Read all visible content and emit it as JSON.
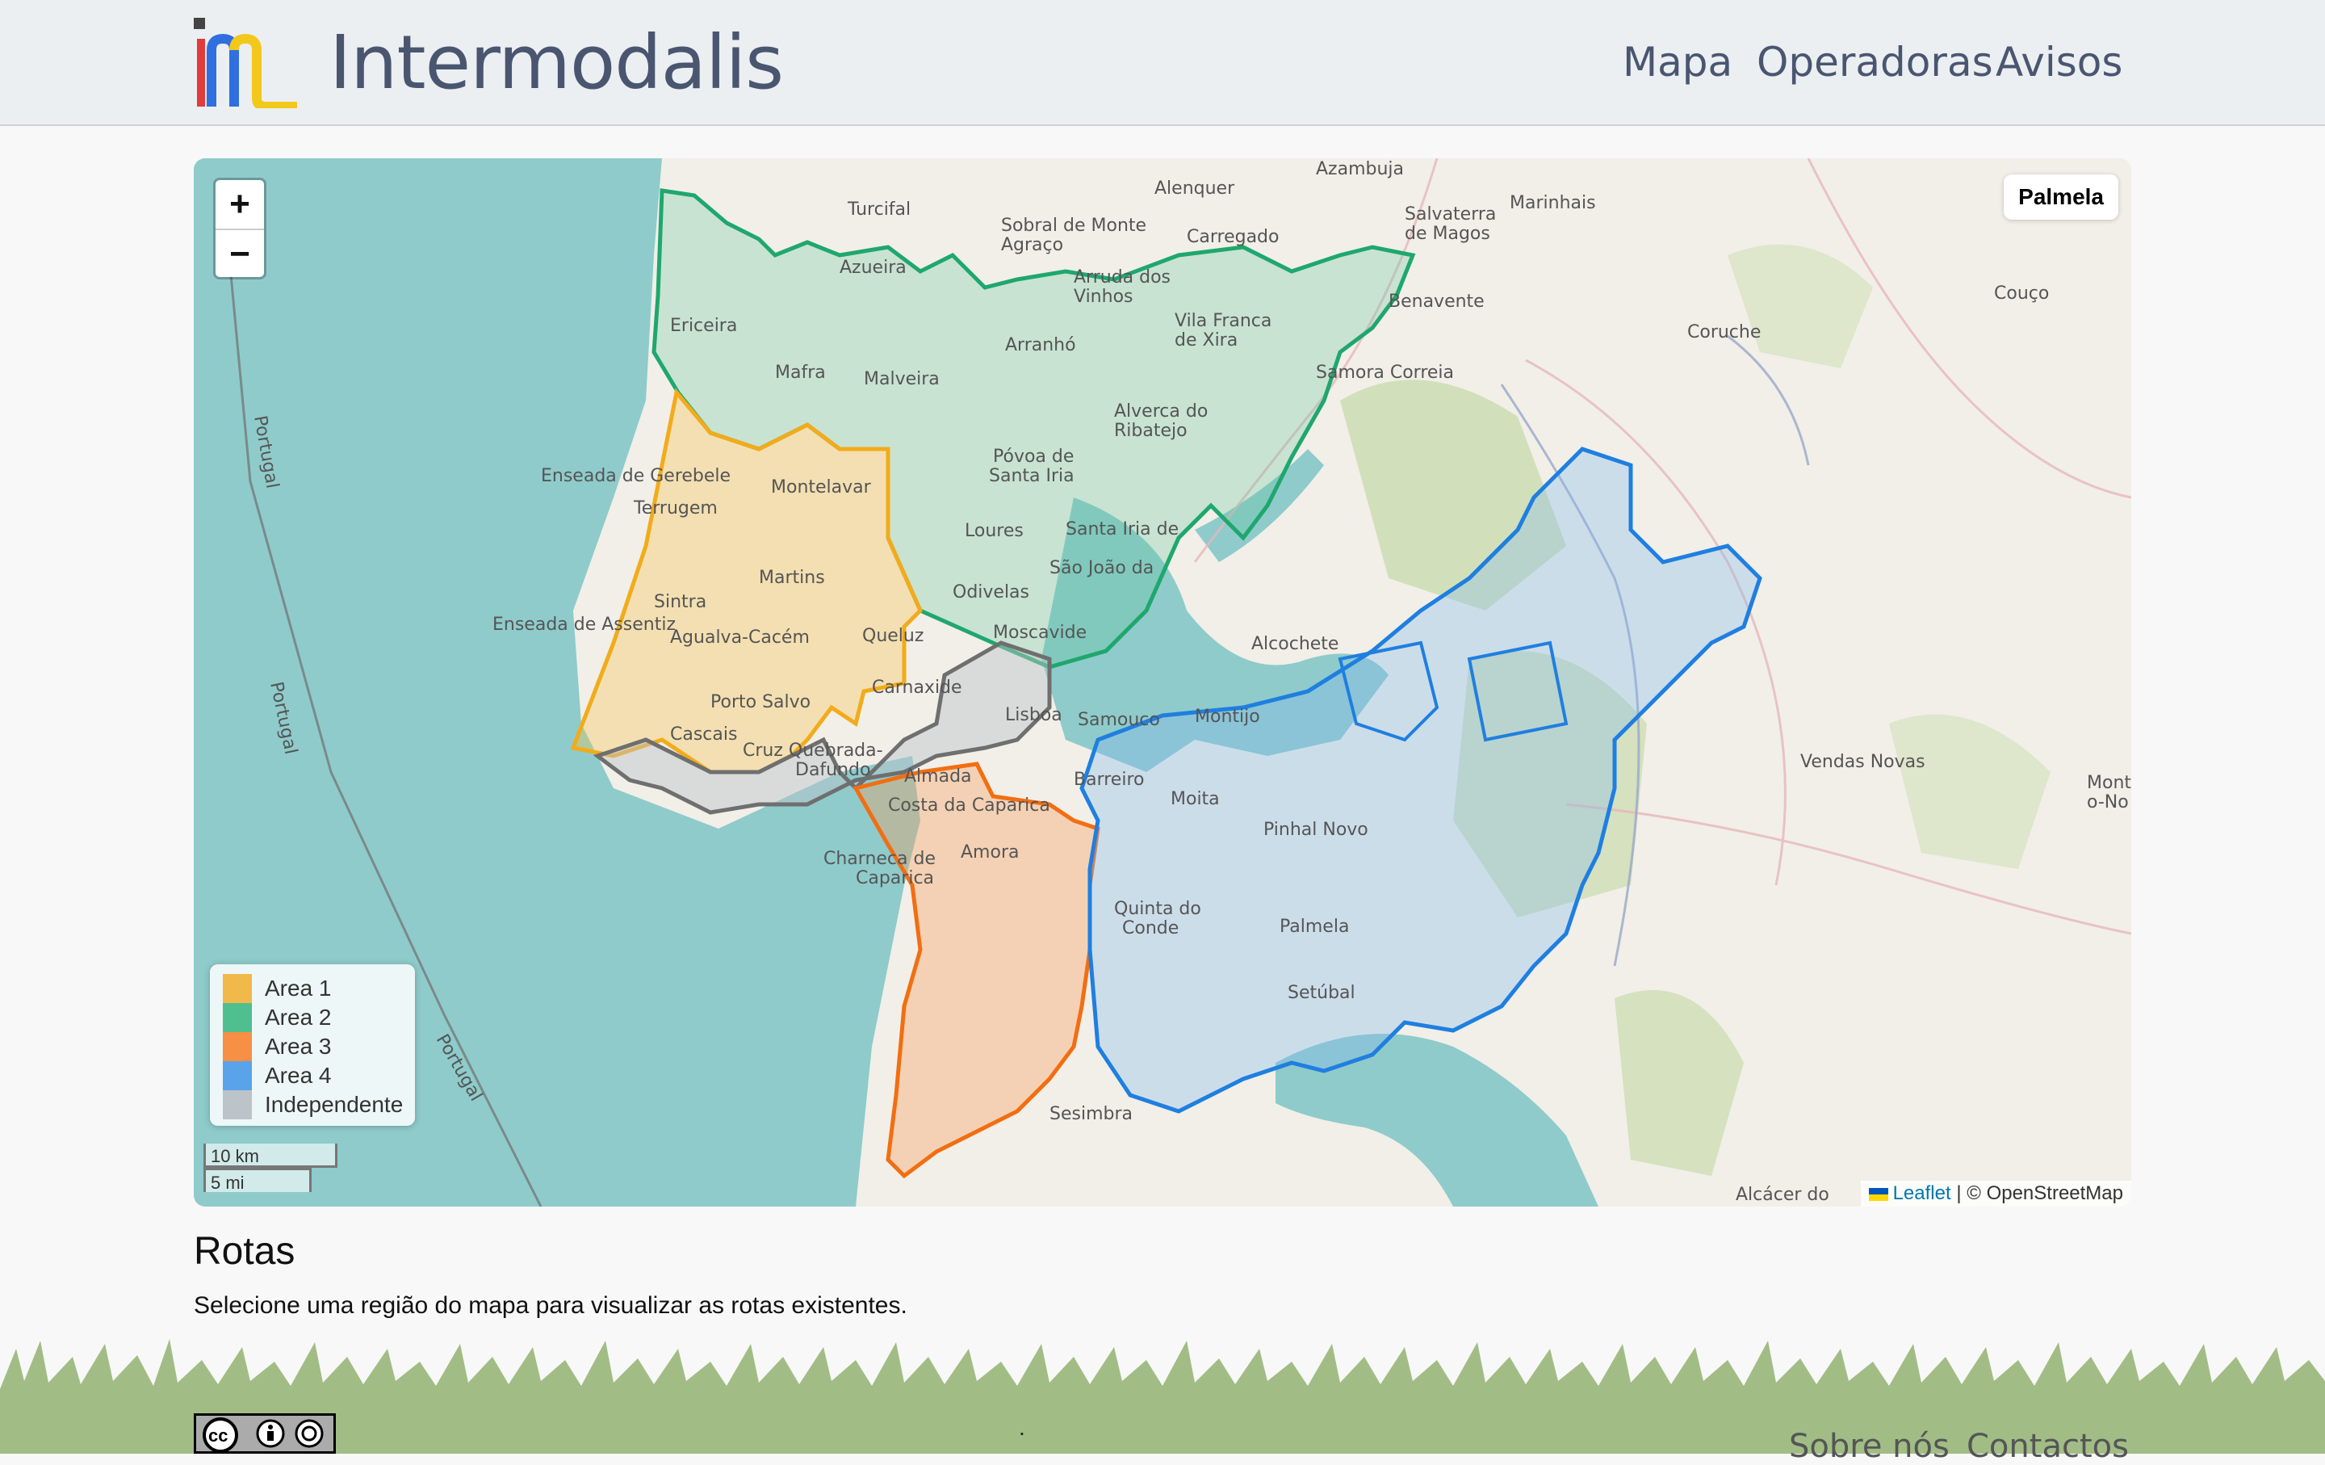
{
  "header": {
    "brand": "Intermodalis",
    "nav": [
      "Mapa",
      "Operadoras",
      "Avisos"
    ]
  },
  "map": {
    "zoom_in": "+",
    "zoom_out": "−",
    "hovered_region": "Palmela",
    "legend": [
      {
        "label": "Area 1",
        "color": "#f0b94a"
      },
      {
        "label": "Area 2",
        "color": "#4fbf8f"
      },
      {
        "label": "Area 3",
        "color": "#f78f45"
      },
      {
        "label": "Area 4",
        "color": "#5aa3ea"
      },
      {
        "label": "Independente",
        "color": "#bcc4c9"
      }
    ],
    "scale": [
      "10 km",
      "5 mi"
    ],
    "attribution_leaflet": "Leaflet",
    "attribution_rest": "| © OpenStreetMap",
    "place_labels": [
      "Azambuja",
      "Alenquer",
      "Turcifal",
      "Sobral de Monte Agraço",
      "Carregado",
      "Salvaterra de Magos",
      "Marinhais",
      "Azueira",
      "Ericeira",
      "Arruda dos Vinhos",
      "Vila Franca de Xira",
      "Benavente",
      "Mafra",
      "Malveira",
      "Arranhó",
      "Samora Correia",
      "Coruche",
      "Couço",
      "Alverca do Ribatejo",
      "Póvoa de Santa Iria",
      "Enseada de Gerebele",
      "Montelavar",
      "Terrugem",
      "Loures",
      "Santa Iria de Azóia",
      "São João da Talha",
      "Martins",
      "Sintra",
      "Enseada de Assentiz",
      "Agualva-Cacém",
      "Queluz",
      "Odivelas",
      "Moscavide",
      "Alcochete",
      "Porto Salvo",
      "Carnaxide",
      "Lisboa",
      "Samouco",
      "Montijo",
      "Cascais",
      "Cruz Quebrada-Dafundo",
      "Almada",
      "Barreiro",
      "Costa da Caparica",
      "Moita",
      "Pinhal Novo",
      "Vendas Novas",
      "Charneca de Caparica",
      "Amora",
      "Quinta do Conde",
      "Palmela",
      "Setúbal",
      "Sesimbra",
      "Alcácer do",
      "Portugal",
      "Portugal",
      "Portugal",
      "Mont o-No"
    ]
  },
  "rotas": {
    "title": "Rotas",
    "text": "Selecione uma região do mapa para visualizar as rotas existentes."
  },
  "footer": {
    "license_icons": [
      "cc-icon",
      "by-icon",
      "sa-icon"
    ],
    "dot": ".",
    "links": [
      "Sobre nós",
      "Contactos"
    ]
  }
}
